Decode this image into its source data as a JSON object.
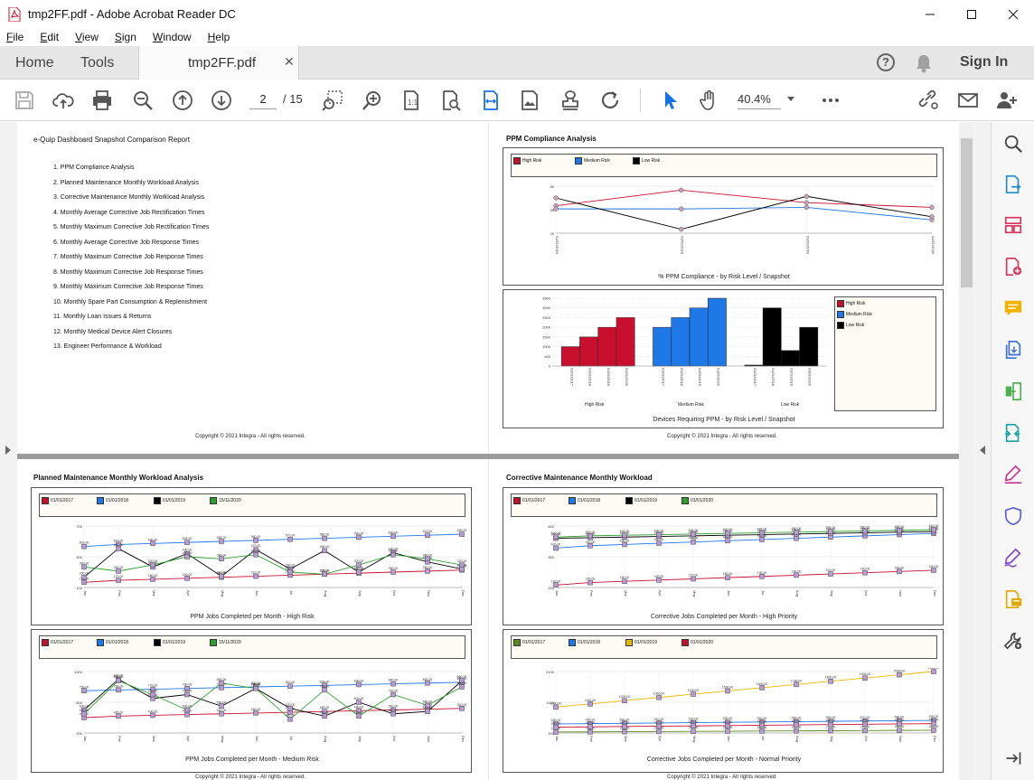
{
  "window": {
    "title": "tmp2FF.pdf - Adobe Acrobat Reader DC"
  },
  "menu": [
    "File",
    "Edit",
    "View",
    "Sign",
    "Window",
    "Help"
  ],
  "tabs": {
    "home": "Home",
    "tools": "Tools",
    "document": "tmp2FF.pdf",
    "sign_in": "Sign In"
  },
  "toolbar": {
    "page_current": "2",
    "page_total": "/ 15",
    "zoom": "40.4%"
  },
  "pages": {
    "toc": {
      "title": "e-Quip Dashboard Snapshot Comparison Report",
      "items": [
        "1. PPM Compliance Analysis",
        "2. Planned Maintenance Monthly Workload Analysis",
        "3. Corrective Maintenance Monthly Workload Analysis",
        "4. Monthly Average Corrective Job Rectification Times",
        "5. Monthly Maximum Corrective Job Rectification Times",
        "6. Monthly Average Corrective Job Response Times",
        "7. Monthly Maximum Corrective Job Response Times",
        "8. Monthly Maximum Corrective Job Response Times",
        "9. Monthly Maximum Corrective Job Response Times",
        "10. Monthly Spare Part Consumption & Replenishment",
        "11. Monthly Loan Issues & Returns",
        "12. Monthly Medical Device Alert Closures",
        "13. Engineer Performance & Workload"
      ],
      "copyright": "Copyright © 2021 Integra - All rights reserved."
    },
    "ppm": {
      "title": "PPM Compliance Analysis",
      "legend": [
        "High Risk",
        "Medium Risk",
        "Low Risk"
      ],
      "line_caption": "% PPM Compliance - by Risk Level / Snapshot",
      "bar_caption": "Devices Requiring PPM - by Risk Level / Snapshot",
      "bar_legend": [
        "High Risk",
        "Medium Risk",
        "Low Risk"
      ],
      "bar_groups": [
        "High Risk",
        "Medium Risk",
        "Low Risk"
      ],
      "copyright": "Copyright © 2021 Integra - All rights reserved."
    },
    "planned": {
      "title": "Planned Maintenance Monthly Workload Analysis",
      "legend": [
        "01/01/2017",
        "01/01/2018",
        "01/01/2019",
        "15/11/2020"
      ],
      "caption_high": "PPM Jobs Completed per Month - High Risk",
      "caption_medium": "PPM Jobs Completed per Month - Medium Risk",
      "copyright": "Copyright © 2021 Integra - All rights reserved."
    },
    "corrective": {
      "title": "Corrective Maintenance Monthly Workload",
      "legend_high": [
        "01/01/2017",
        "01/01/2018",
        "01/01/2019",
        "01/01/2020"
      ],
      "legend_normal": [
        "01/01/2017",
        "01/01/2018",
        "01/01/2019",
        "01/01/2020"
      ],
      "caption_high": "Corrective Jobs Completed per Month - High Priority",
      "caption_normal": "Corrective Jobs Completed per Month - Normal Priority",
      "copyright": "Copyright © 2021 Integra - All rights reserved."
    }
  },
  "colors": {
    "red": "#c8102e",
    "blue": "#1e78e6",
    "black": "#000000",
    "green": "#2ca02c",
    "olive": "#5a8a1a",
    "yellow": "#e8b800",
    "accent": "#1473e6"
  },
  "chart_data": [
    {
      "type": "line",
      "title": "% PPM Compliance - by Risk Level / Snapshot",
      "x": [
        "01/01/2016",
        "01/01/2018",
        "01/01/2019",
        "01/01/2020"
      ],
      "series": [
        {
          "name": "High Risk",
          "values": [
            60,
            80,
            64,
            58
          ]
        },
        {
          "name": "Medium Risk",
          "values": [
            56,
            56,
            58,
            42
          ]
        },
        {
          "name": "Low Risk",
          "values": [
            70,
            30,
            72,
            46
          ]
        }
      ]
    },
    {
      "type": "bar",
      "title": "Devices Requiring PPM - by Risk Level / Snapshot",
      "categories": [
        "01/01/2017",
        "01/01/2018",
        "01/01/2019",
        "01/01/2020"
      ],
      "ylim": [
        0,
        3500
      ],
      "series": [
        {
          "name": "High Risk",
          "values": [
            1000,
            1500,
            2000,
            2500
          ]
        },
        {
          "name": "Medium Risk",
          "values": [
            2000,
            2500,
            3000,
            3500
          ]
        },
        {
          "name": "Low Risk",
          "values": [
            50,
            3000,
            800,
            2000
          ]
        }
      ]
    },
    {
      "type": "line",
      "title": "PPM Jobs Completed per Month - High Risk",
      "categories": [
        "Jan",
        "Feb",
        "Mar",
        "Apr",
        "May",
        "Jun",
        "Jul",
        "Aug",
        "Sep",
        "Oct",
        "Nov",
        "Dec"
      ],
      "ylim": [
        100,
        700
      ],
      "series": [
        {
          "name": "01/01/2017",
          "values": [
            150,
            170,
            180,
            190,
            200,
            210,
            220,
            230,
            240,
            250,
            260,
            270
          ]
        },
        {
          "name": "01/01/2018",
          "values": [
            500,
            520,
            530,
            540,
            550,
            560,
            570,
            580,
            590,
            600,
            610,
            620
          ]
        },
        {
          "name": "01/01/2019",
          "values": [
            200,
            480,
            300,
            430,
            210,
            470,
            280,
            460,
            250,
            440,
            350,
            280
          ]
        },
        {
          "name": "15/11/2020",
          "values": [
            300,
            260,
            320,
            400,
            380,
            420,
            250,
            230,
            320,
            420,
            380,
            320
          ]
        }
      ]
    },
    {
      "type": "line",
      "title": "PPM Jobs Completed per Month - Medium Risk",
      "categories": [
        "Jan",
        "Feb",
        "Mar",
        "Apr",
        "May",
        "Jun",
        "Jul",
        "Aug",
        "Sep",
        "Oct",
        "Nov",
        "Dec"
      ],
      "ylim": [
        200,
        1000
      ],
      "series": [
        {
          "name": "01/01/2017",
          "values": [
            400,
            420,
            430,
            440,
            450,
            460,
            470,
            480,
            490,
            500,
            510,
            520
          ]
        },
        {
          "name": "01/01/2018",
          "values": [
            750,
            760,
            770,
            780,
            790,
            800,
            810,
            820,
            830,
            840,
            850,
            860
          ]
        },
        {
          "name": "01/01/2019",
          "values": [
            500,
            900,
            650,
            700,
            550,
            780,
            520,
            420,
            600,
            450,
            480,
            880
          ]
        },
        {
          "name": "15/11/2020",
          "values": [
            450,
            880,
            700,
            500,
            850,
            780,
            380,
            760,
            420,
            700,
            560,
            800
          ]
        }
      ]
    },
    {
      "type": "line",
      "title": "Corrective Jobs Completed per Month - High Priority",
      "categories": [
        "Jan",
        "Feb",
        "Mar",
        "Apr",
        "May",
        "Jun",
        "Jul",
        "Aug",
        "Sep",
        "Oct",
        "Nov",
        "Dec"
      ],
      "ylim": [
        100,
        600
      ],
      "series": [
        {
          "name": "01/01/2017",
          "values": [
            120,
            140,
            150,
            160,
            170,
            180,
            190,
            200,
            210,
            220,
            230,
            240
          ]
        },
        {
          "name": "01/01/2018",
          "values": [
            420,
            440,
            450,
            460,
            470,
            480,
            490,
            500,
            510,
            520,
            530,
            540
          ]
        },
        {
          "name": "01/01/2019",
          "values": [
            500,
            505,
            510,
            515,
            520,
            525,
            530,
            535,
            540,
            545,
            550,
            555
          ]
        },
        {
          "name": "01/01/2020",
          "values": [
            510,
            520,
            525,
            530,
            535,
            540,
            545,
            550,
            555,
            560,
            565,
            570
          ]
        }
      ]
    },
    {
      "type": "line",
      "title": "Corrective Jobs Completed per Month - Normal Priority",
      "categories": [
        "Jan",
        "Feb",
        "Mar",
        "Apr",
        "May",
        "Jun",
        "Jul",
        "Aug",
        "Sep",
        "Oct",
        "Nov",
        "Dec"
      ],
      "ylim": [
        200,
        2100
      ],
      "series": [
        {
          "name": "01/01/2017",
          "values": [
            230,
            235,
            240,
            245,
            250,
            255,
            260,
            265,
            270,
            275,
            280,
            285
          ]
        },
        {
          "name": "01/01/2018",
          "values": [
            480,
            490,
            500,
            510,
            520,
            530,
            540,
            550,
            560,
            570,
            580,
            590
          ]
        },
        {
          "name": "01/01/2019",
          "values": [
            1000,
            1100,
            1200,
            1300,
            1400,
            1500,
            1600,
            1700,
            1800,
            1900,
            2000,
            2100
          ]
        },
        {
          "name": "01/01/2020",
          "values": [
            380,
            390,
            400,
            410,
            420,
            430,
            440,
            450,
            460,
            470,
            480,
            490
          ]
        }
      ]
    }
  ]
}
